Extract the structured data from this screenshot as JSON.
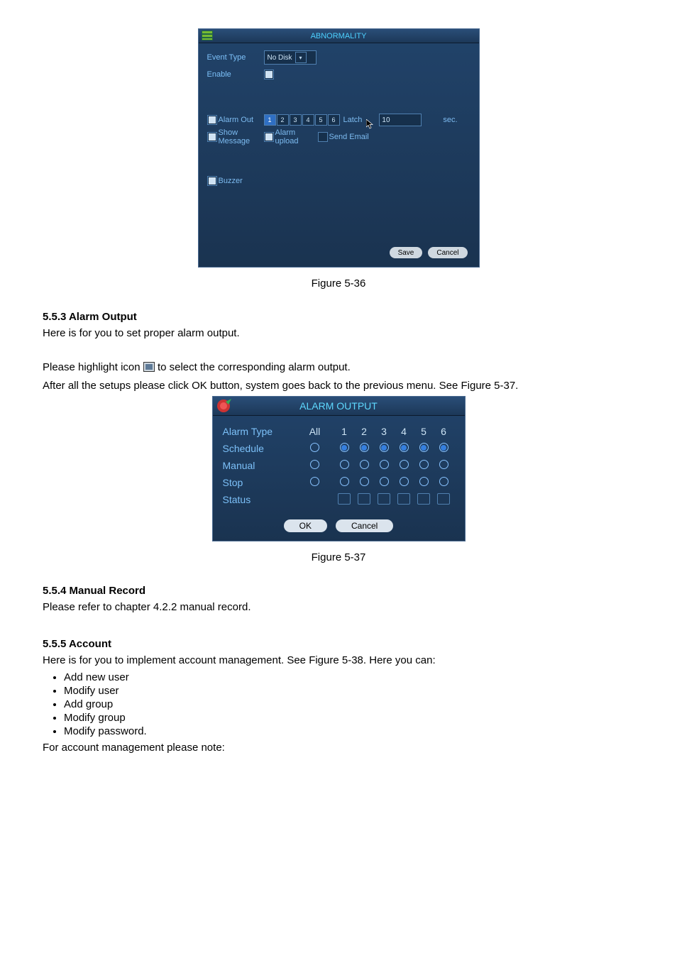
{
  "panel1": {
    "title": "ABNORMALITY",
    "event_type_label": "Event Type",
    "event_type_value": "No Disk",
    "enable_label": "Enable",
    "alarm_out_label": "Alarm Out",
    "channels": [
      "1",
      "2",
      "3",
      "4",
      "5",
      "6"
    ],
    "channel_active_index": 0,
    "latch_label": "Latch",
    "latch_value": "10",
    "sec_label": "sec.",
    "show_message_label": "Show Message",
    "alarm_upload_label": "Alarm upload",
    "send_email_label": "Send Email",
    "buzzer_label": "Buzzer",
    "save_label": "Save",
    "cancel_label": "Cancel"
  },
  "fig1_caption": "Figure 5-36",
  "section_553_heading": "5.5.3  Alarm Output",
  "section_553_p1": "Here is for you to set proper alarm output.",
  "section_553_p2a": "Please highlight icon ",
  "section_553_p2b": " to select the corresponding alarm output.",
  "section_553_p3": "After all the setups please click OK button, system goes back to the previous menu. See Figure 5-37.",
  "panel2": {
    "title": "ALARM OUTPUT",
    "alarm_type_label": "Alarm Type",
    "all_label": "All",
    "cols": [
      "1",
      "2",
      "3",
      "4",
      "5",
      "6"
    ],
    "rows": [
      {
        "label": "Schedule",
        "all": "open",
        "cells": [
          "fill",
          "fill",
          "fill",
          "fill",
          "fill",
          "fill"
        ]
      },
      {
        "label": "Manual",
        "all": "open",
        "cells": [
          "open",
          "open",
          "open",
          "open",
          "open",
          "open"
        ]
      },
      {
        "label": "Stop",
        "all": "open",
        "cells": [
          "open",
          "open",
          "open",
          "open",
          "open",
          "open"
        ]
      }
    ],
    "status_label": "Status",
    "ok_label": "OK",
    "cancel_label": "Cancel"
  },
  "fig2_caption": "Figure 5-37",
  "section_554_heading": "5.5.4  Manual Record",
  "section_554_p1": "Please refer to chapter 4.2.2 manual record.",
  "section_555_heading": "5.5.5  Account",
  "section_555_p1": "Here is for you to implement account management.  See Figure 5-38.  Here you can:",
  "section_555_bullets": [
    "Add new user",
    "Modify user",
    "Add group",
    "Modify group",
    "Modify password."
  ],
  "section_555_p2": "For account management please note:"
}
